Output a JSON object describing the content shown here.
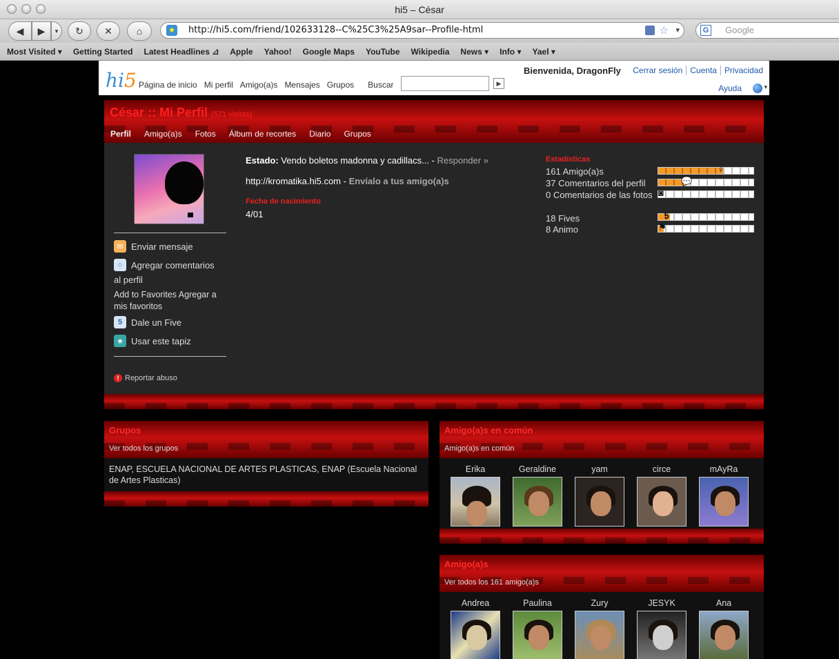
{
  "browser": {
    "window_title": "hi5 – César",
    "url": "http://hi5.com/friend/102633128--C%25C3%25A9sar--Profile-html",
    "search_placeholder": "Google",
    "bookmarks": [
      "Most Visited ▾",
      "Getting Started",
      "Latest Headlines ⊿",
      "Apple",
      "Yahoo!",
      "Google Maps",
      "YouTube",
      "Wikipedia",
      "News ▾",
      "Info ▾",
      "Yael ▾"
    ]
  },
  "header": {
    "logo_h": "hi",
    "logo_five": "5",
    "nav": [
      "Página de inicio",
      "Mi perfil",
      "Amigo(a)s",
      "Mensajes",
      "Grupos"
    ],
    "search_label": "Buscar",
    "welcome": "Bienvenida, DragonFly",
    "links": [
      "Cerrar sesión",
      "Cuenta",
      "Privacidad"
    ],
    "help": "Ayuda"
  },
  "profile": {
    "title": "César :: Mi Perfil",
    "visits": "(571 visitas)",
    "tabs": [
      "Perfil",
      "Amigo(a)s",
      "Fotos",
      "Álbum de recortes",
      "Diario",
      "Grupos"
    ],
    "actions": {
      "message": "Enviar mensaje",
      "comment_1": "Agregar comentarios",
      "comment_2": "al perfil",
      "favorites_1": "Add to Favorites Agregar a",
      "favorites_2": "mis favoritos",
      "five": "Dale un Five",
      "wallpaper": "Usar este tapiz",
      "report": "Reportar abuso"
    },
    "status_label": "Estado:",
    "status_text": "Vendo boletos madonna y cadillacs...",
    "status_sep": " - ",
    "reply": "Responder »",
    "site_url": "http://kromatika.hi5.com",
    "site_sep": " - ",
    "send_to_friends": "Envíalo a tus amigo(a)s",
    "birthday_label": "Fecha de nacimiento",
    "birthday": "4/01",
    "stats_title": "Estadísticas",
    "stats": [
      {
        "label": "161 Amigo(a)s",
        "level": 0.68
      },
      {
        "label": "37 Comentarios del perfil",
        "level": 0.3
      },
      {
        "label": "0 Comentarios de las fotos",
        "level": 0.0
      },
      {
        "label": "18 Fives",
        "level": 0.12
      },
      {
        "label": "8 Animo",
        "level": 0.06
      }
    ]
  },
  "groups": {
    "title": "Grupos",
    "subtitle": "Ver todos los grupos",
    "text": "ENAP, ESCUELA NACIONAL DE ARTES PLASTICAS, ENAP (Escuela Nacional de Artes Plasticas)"
  },
  "common_friends": {
    "title": "Amigo(a)s en común",
    "subtitle": "Amigo(a)s en común",
    "people": [
      "Erika",
      "Geraldine",
      "yam",
      "circe",
      "mAyRa"
    ]
  },
  "friends": {
    "title": "Amigo(a)s",
    "subtitle": "Ver todos los 161 amigo(a)s",
    "people": [
      "Andrea",
      "Paulina",
      "Zury",
      "JESYK",
      "Ana"
    ]
  }
}
